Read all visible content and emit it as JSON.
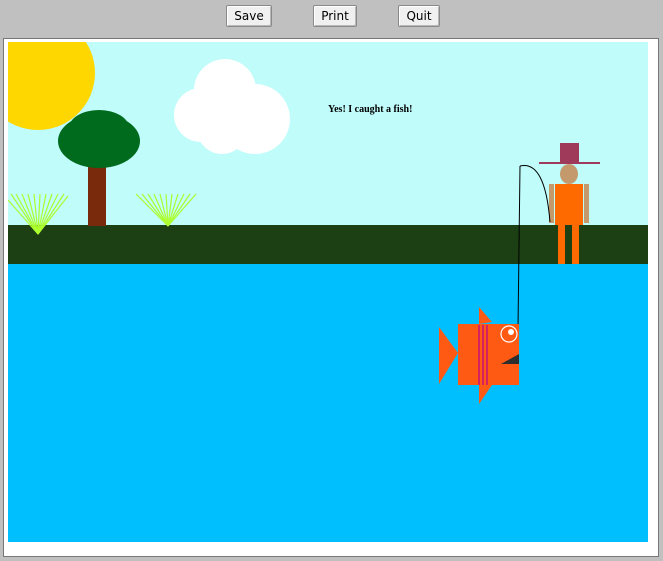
{
  "toolbar": {
    "save_label": "Save",
    "print_label": "Print",
    "quit_label": "Quit"
  },
  "scene": {
    "message": "Yes! I caught a fish!",
    "colors": {
      "sky": "#bffcfa",
      "sun": "#ffd700",
      "cloud": "#ffffff",
      "grass": "#1c4014",
      "water": "#00bfff",
      "tree_trunk": "#7a2a0c",
      "tree_leaves": "#006a1d",
      "bush": "#adff2f",
      "hat": "#a03a5a",
      "skin": "#c49a6c",
      "clothes": "#ff6a00",
      "fish": "#ff5a14",
      "fish_stripe": "#c8107a"
    }
  }
}
